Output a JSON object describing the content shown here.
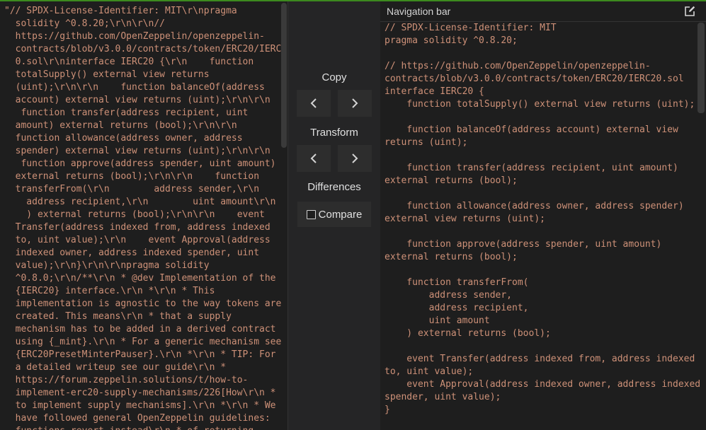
{
  "raw_panel": {
    "lines": [
      "\"// SPDX-License-Identifier: MIT\\r\\npragma",
      "  solidity ^0.8.20;\\r\\n\\r\\n//",
      "  https://github.com/OpenZeppelin/openzeppelin-",
      "  contracts/blob/v3.0.0/contracts/token/ERC20/IERC2",
      "  0.sol\\r\\ninterface IERC20 {\\r\\n    function",
      "  totalSupply() external view returns",
      "  (uint);\\r\\n\\r\\n    function balanceOf(address",
      "  account) external view returns (uint);\\r\\n\\r\\n",
      "   function transfer(address recipient, uint",
      "  amount) external returns (bool);\\r\\n\\r\\n",
      "  function allowance(address owner, address",
      "  spender) external view returns (uint);\\r\\n\\r\\n",
      "   function approve(address spender, uint amount)",
      "  external returns (bool);\\r\\n\\r\\n    function",
      "  transferFrom(\\r\\n        address sender,\\r\\n",
      "    address recipient,\\r\\n        uint amount\\r\\n",
      "    ) external returns (bool);\\r\\n\\r\\n    event",
      "  Transfer(address indexed from, address indexed",
      "  to, uint value);\\r\\n    event Approval(address",
      "  indexed owner, address indexed spender, uint",
      "  value);\\r\\n}\\r\\n\\r\\npragma solidity",
      "  ^0.8.0;\\r\\n/**\\r\\n * @dev Implementation of the",
      "  {IERC20} interface.\\r\\n *\\r\\n * This",
      "  implementation is agnostic to the way tokens are",
      "  created. This means\\r\\n * that a supply",
      "  mechanism has to be added in a derived contract",
      "  using {_mint}.\\r\\n * For a generic mechanism see",
      "  {ERC20PresetMinterPauser}.\\r\\n *\\r\\n * TIP: For",
      "  a detailed writeup see our guide\\r\\n *",
      "  https://forum.zeppelin.solutions/t/how-to-",
      "  implement-erc20-supply-mechanisms/226[How\\r\\n *",
      "  to implement supply mechanisms].\\r\\n *\\r\\n * We",
      "  have followed general OpenZeppelin guidelines:",
      "  functions revert instead\\r\\n * of returning"
    ]
  },
  "controls": {
    "copy_label": "Copy",
    "transform_label": "Transform",
    "differences_label": "Differences",
    "compare_label": "Compare",
    "compare_checked": false,
    "prev_icon": "chevron-left-icon",
    "next_icon": "chevron-right-icon"
  },
  "formatted_panel": {
    "title": "Navigation bar",
    "edit_icon": "edit-icon",
    "lines": [
      "// SPDX-License-Identifier: MIT",
      "pragma solidity ^0.8.20;",
      "",
      "// https://github.com/OpenZeppelin/openzeppelin-",
      "contracts/blob/v3.0.0/contracts/token/ERC20/IERC20.sol",
      "interface IERC20 {",
      "    function totalSupply() external view returns (uint);",
      "",
      "    function balanceOf(address account) external view",
      "returns (uint);",
      "",
      "    function transfer(address recipient, uint amount)",
      "external returns (bool);",
      "",
      "    function allowance(address owner, address spender)",
      "external view returns (uint);",
      "",
      "    function approve(address spender, uint amount)",
      "external returns (bool);",
      "",
      "    function transferFrom(",
      "        address sender,",
      "        address recipient,",
      "        uint amount",
      "    ) external returns (bool);",
      "",
      "    event Transfer(address indexed from, address indexed",
      "to, uint value);",
      "    event Approval(address indexed owner, address indexed",
      "spender, uint value);",
      "}"
    ]
  },
  "colors": {
    "code_text": "#ce9178",
    "accent_top": "#3c8a1e"
  }
}
